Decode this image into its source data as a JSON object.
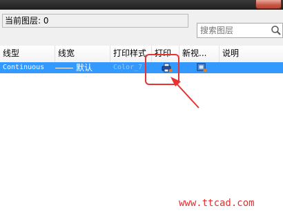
{
  "current_layer": {
    "text": "当前图层: 0"
  },
  "search": {
    "placeholder": "搜索图层",
    "icon": "search-icon"
  },
  "columns": [
    "线型",
    "线宽",
    "打印样式",
    "打印",
    "新视...",
    "说明"
  ],
  "row": {
    "linetype": "Continuous",
    "lineweight": "默认",
    "plotstyle": "Color_7",
    "plot_icon": "printer-icon",
    "newvp_icon": "viewport-freeze-icon",
    "description": ""
  },
  "colors": {
    "selection": "#3399ff",
    "annotation": "#e53333"
  },
  "watermark": "www.ttcad.com"
}
